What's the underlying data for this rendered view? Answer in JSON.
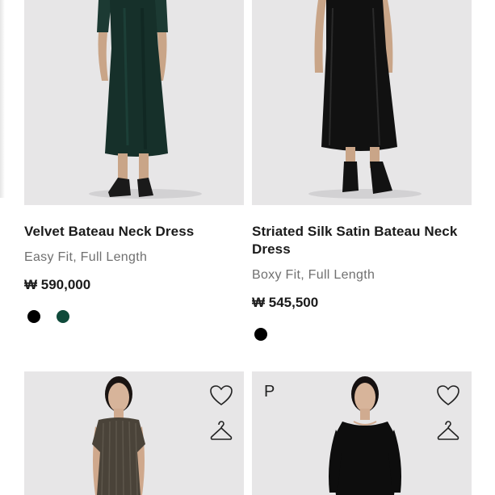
{
  "products": [
    {
      "name": "Velvet Bateau Neck Dress",
      "fit": "Easy Fit, Full Length",
      "price": "₩ 590,000",
      "swatch_colors": [
        "#000000",
        "#0f4a3a"
      ],
      "dress_color": "#16302a"
    },
    {
      "name_line1": "Striated Silk Satin Bateau Neck",
      "name_line2": "Dress",
      "fit": "Boxy Fit, Full Length",
      "price": "₩ 545,500",
      "swatch_colors": [
        "#000000"
      ],
      "dress_color": "#111111"
    },
    {
      "dress_color": "#4a4339",
      "icons": [
        "heart-icon",
        "hanger-icon"
      ]
    },
    {
      "badge": "P",
      "dress_color": "#0d0d0d",
      "icons": [
        "heart-icon",
        "hanger-icon"
      ]
    }
  ]
}
